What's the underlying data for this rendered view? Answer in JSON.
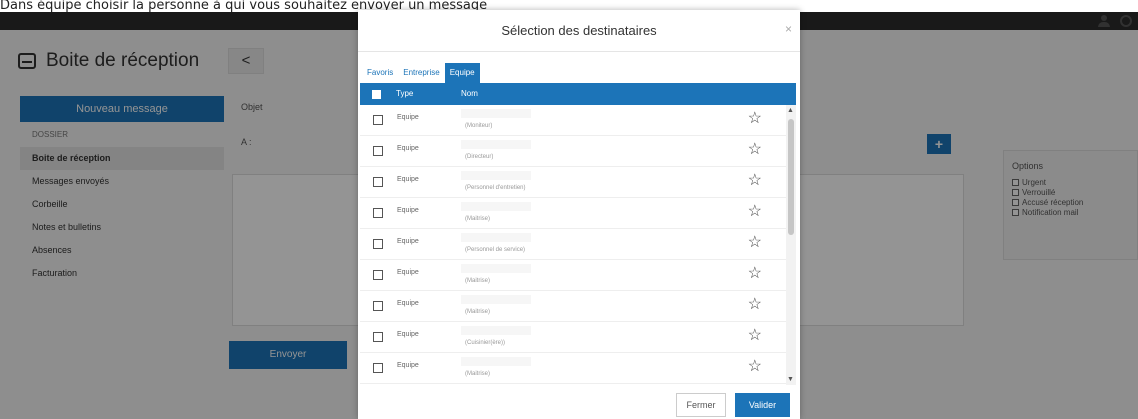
{
  "caption": "Dans équipe choisir la personne à qui vous souhaitez envoyer un message",
  "page": {
    "inbox_title": "Boite de réception",
    "back_label": "<",
    "new_message": "Nouveau message",
    "sidebar_header": "DOSSIER",
    "sidebar_items": [
      {
        "label": "Boite de réception",
        "active": true
      },
      {
        "label": "Messages envoyés",
        "active": false
      },
      {
        "label": "Corbeille",
        "active": false
      },
      {
        "label": "Notes et bulletins",
        "active": false
      },
      {
        "label": "Absences",
        "active": false
      },
      {
        "label": "Facturation",
        "active": false
      }
    ],
    "subject_label": "Objet",
    "to_label": "A :",
    "add_label": "+",
    "send_label": "Envoyer",
    "options": {
      "title": "Options",
      "items": [
        "Urgent",
        "Verrouillé",
        "Accusé réception",
        "Notification mail"
      ]
    }
  },
  "modal": {
    "title": "Sélection des destinataires",
    "close_icon": "×",
    "tabs": [
      {
        "label": "Favoris",
        "active": false
      },
      {
        "label": "Entreprise",
        "active": false
      },
      {
        "label": "Equipe",
        "active": true
      }
    ],
    "columns": {
      "type": "Type",
      "name": "Nom"
    },
    "rows": [
      {
        "type": "Equipe",
        "role": "(Moniteur)"
      },
      {
        "type": "Equipe",
        "role": "(Directeur)"
      },
      {
        "type": "Equipe",
        "role": "(Personnel d'entretien)"
      },
      {
        "type": "Equipe",
        "role": "(Maitrise)"
      },
      {
        "type": "Equipe",
        "role": "(Personnel de service)"
      },
      {
        "type": "Equipe",
        "role": "(Maitrise)"
      },
      {
        "type": "Equipe",
        "role": "(Maitrise)"
      },
      {
        "type": "Equipe",
        "role": "(Cuisinier(ère))"
      },
      {
        "type": "Equipe",
        "role": "(Maitrise)"
      }
    ],
    "star_icon": "☆",
    "close_button": "Fermer",
    "validate_button": "Valider"
  },
  "colors": {
    "accent": "#1c74b8",
    "topbar": "#2b2b2b"
  }
}
